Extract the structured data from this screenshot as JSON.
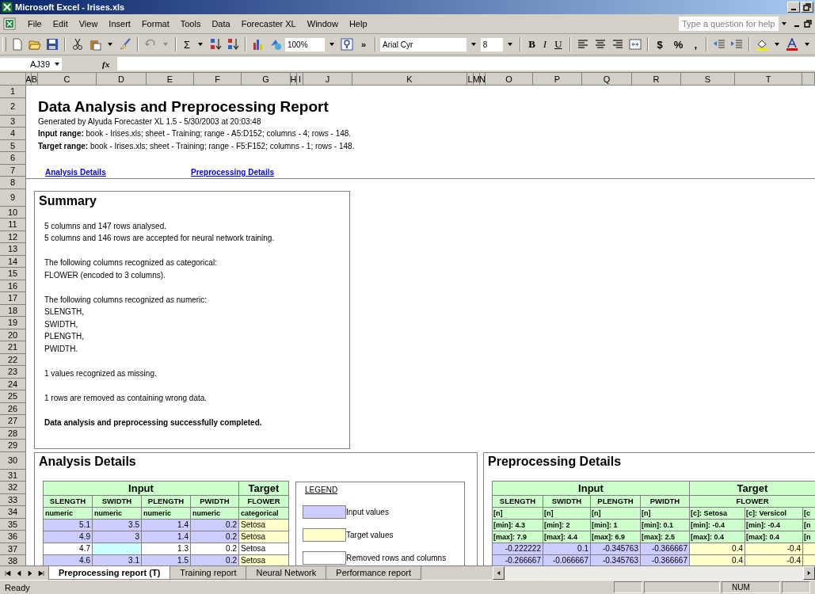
{
  "window": {
    "title": "Microsoft Excel - Irises.xls"
  },
  "menu": [
    "File",
    "Edit",
    "View",
    "Insert",
    "Format",
    "Tools",
    "Data",
    "Forecaster XL",
    "Window",
    "Help"
  ],
  "help_box": {
    "placeholder": "Type a question for help"
  },
  "toolbar": {
    "sum": "Σ",
    "zoom": "100%",
    "more": "»",
    "font": "Arial Cyr",
    "font_size": "8",
    "format_buttons": [
      "B",
      "I",
      "U"
    ],
    "number_buttons": [
      "$",
      "%",
      ","
    ]
  },
  "formula_bar": {
    "cell_ref": "AJ39",
    "fx": "fx"
  },
  "columns": [
    "A",
    "B",
    "C",
    "D",
    "E",
    "F",
    "G",
    "H",
    "I",
    "J",
    "K",
    "L",
    "M",
    "N",
    "O",
    "P",
    "Q",
    "R",
    "S",
    "T"
  ],
  "rows": [
    "1",
    "2",
    "3",
    "4",
    "5",
    "6",
    "7",
    "8",
    "9",
    "10",
    "11",
    "12",
    "13",
    "14",
    "15",
    "16",
    "17",
    "18",
    "19",
    "20",
    "21",
    "22",
    "23",
    "24",
    "25",
    "26",
    "27",
    "28",
    "29",
    "30",
    "31",
    "32",
    "33",
    "34",
    "35",
    "36",
    "37",
    "38"
  ],
  "report": {
    "title": "Data Analysis and Preprocessing Report",
    "lines": [
      "Generated by Alyuda Forecaster XL 1.5 - 5/30/2003 at 20:03:48",
      "**Input range:** book - Irises.xls; sheet - Training; range - A5:D152; columns - 4; rows - 148.",
      "**Target range:** book - Irises.xls; sheet - Training; range - F5:F152; columns - 1; rows - 148."
    ],
    "links": [
      "Analysis Details",
      "Preprocessing Details"
    ]
  },
  "summary": {
    "title": "Summary",
    "groups": [
      [
        {
          "text": "5 columns and 147 rows analysed.",
          "bold": false
        },
        {
          "text": "5 columns and 146 rows are accepted for neural network training.",
          "bold": false
        }
      ],
      [
        {
          "text": "The following columns recognized as categorical:",
          "bold": false
        },
        {
          "text": "FLOWER (encoded to 3 columns).",
          "bold": false
        }
      ],
      [
        {
          "text": "The following columns recognized as numeric:",
          "bold": false
        },
        {
          "text": "SLENGTH,",
          "bold": false
        },
        {
          "text": "SWIDTH,",
          "bold": false
        },
        {
          "text": "PLENGTH,",
          "bold": false
        },
        {
          "text": "PWIDTH.",
          "bold": false
        }
      ],
      [
        {
          "text": "1 values recognized as missing.",
          "bold": false
        }
      ],
      [
        {
          "text": "1 rows are removed as containing wrong data.",
          "bold": false
        }
      ],
      [
        {
          "text": "Data analysis and preprocessing successfully completed.",
          "bold": true
        }
      ]
    ]
  },
  "analysis": {
    "title": "Analysis Details",
    "table": {
      "groups": [
        {
          "label": "Input",
          "kind": "input",
          "columns": [
            {
              "name": "SLENGTH",
              "type": "numeric"
            },
            {
              "name": "SWIDTH",
              "type": "numeric"
            },
            {
              "name": "PLENGTH",
              "type": "numeric"
            },
            {
              "name": "PWIDTH",
              "type": "numeric"
            }
          ]
        },
        {
          "label": "Target",
          "kind": "target",
          "columns": [
            {
              "name": "FLOWER",
              "type": "categorical"
            }
          ]
        }
      ],
      "rows": [
        {
          "removed": false,
          "cells": [
            {
              "text": "5.1",
              "missing": false
            },
            {
              "text": "3.5",
              "missing": false
            },
            {
              "text": "1.4",
              "missing": false
            },
            {
              "text": "0.2",
              "missing": false
            },
            {
              "text": "Setosa",
              "missing": false
            }
          ]
        },
        {
          "removed": false,
          "cells": [
            {
              "text": "4.9",
              "missing": false
            },
            {
              "text": "3",
              "missing": false
            },
            {
              "text": "1.4",
              "missing": false
            },
            {
              "text": "0.2",
              "missing": false
            },
            {
              "text": "Setosa",
              "missing": false
            }
          ]
        },
        {
          "removed": true,
          "cells": [
            {
              "text": "4.7",
              "missing": false
            },
            {
              "missing": true
            },
            {
              "text": "1.3",
              "missing": false
            },
            {
              "text": "0.2",
              "missing": false
            },
            {
              "text": "Setosa",
              "missing": false
            }
          ]
        },
        {
          "removed": false,
          "cells": [
            {
              "text": "4.6",
              "missing": false
            },
            {
              "text": "3.1",
              "missing": false
            },
            {
              "text": "1.5",
              "missing": false
            },
            {
              "text": "0.2",
              "missing": false
            },
            {
              "text": "Setosa",
              "missing": false
            }
          ]
        }
      ]
    },
    "legend": {
      "title": "LEGEND",
      "items": [
        {
          "label": "Input values",
          "color": "#ccccff"
        },
        {
          "label": "Target values",
          "color": "#ffffcc"
        },
        {
          "label": "Removed rows and columns",
          "color": "#ffffff"
        }
      ]
    }
  },
  "preprocessing": {
    "title": "Preprocessing Details",
    "table": {
      "groups": [
        {
          "label": "Input",
          "kind": "input",
          "fields": [
            {
              "name": "SLENGTH",
              "columns": [
                {
                  "type": "[n]",
                  "min": "[min]: 4.3",
                  "max": "[max]: 7.9"
                }
              ]
            },
            {
              "name": "SWIDTH",
              "columns": [
                {
                  "type": "[n]",
                  "min": "[min]: 2",
                  "max": "[max]: 4.4"
                }
              ]
            },
            {
              "name": "PLENGTH",
              "columns": [
                {
                  "type": "[n]",
                  "min": "[min]: 1",
                  "max": "[max]: 6.9"
                }
              ]
            },
            {
              "name": "PWIDTH",
              "columns": [
                {
                  "type": "[n]",
                  "min": "[min]: 0.1",
                  "max": "[max]: 2.5"
                }
              ]
            }
          ]
        },
        {
          "label": "Target",
          "kind": "target",
          "fields": [
            {
              "name": "FLOWER",
              "columns": [
                {
                  "type": "[c]: Setosa",
                  "min": "[min]: -0.4",
                  "max": "[max]: 0.4"
                },
                {
                  "type": "[c]: Versicol",
                  "min": "[min]: -0.4",
                  "max": "[max]: 0.4"
                },
                {
                  "type": "[c",
                  "min": "[n",
                  "max": "[n"
                }
              ]
            }
          ]
        }
      ],
      "rows": [
        {
          "values": [
            "-0.222222",
            "0.1",
            "-0.345763",
            "-0.366667",
            "0.4",
            "-0.4"
          ]
        },
        {
          "values": [
            "-0.266667",
            "-0.066667",
            "-0.345763",
            "-0.366667",
            "0.4",
            "-0.4"
          ]
        }
      ]
    }
  },
  "sheet_tabs": [
    {
      "label": "Preprocessing report (T)",
      "selected": true
    },
    {
      "label": "Training report",
      "selected": false
    },
    {
      "label": "Neural Network",
      "selected": false
    },
    {
      "label": "Performance report",
      "selected": false
    }
  ],
  "status_bar": {
    "left": "Ready",
    "indicator": "NUM"
  }
}
